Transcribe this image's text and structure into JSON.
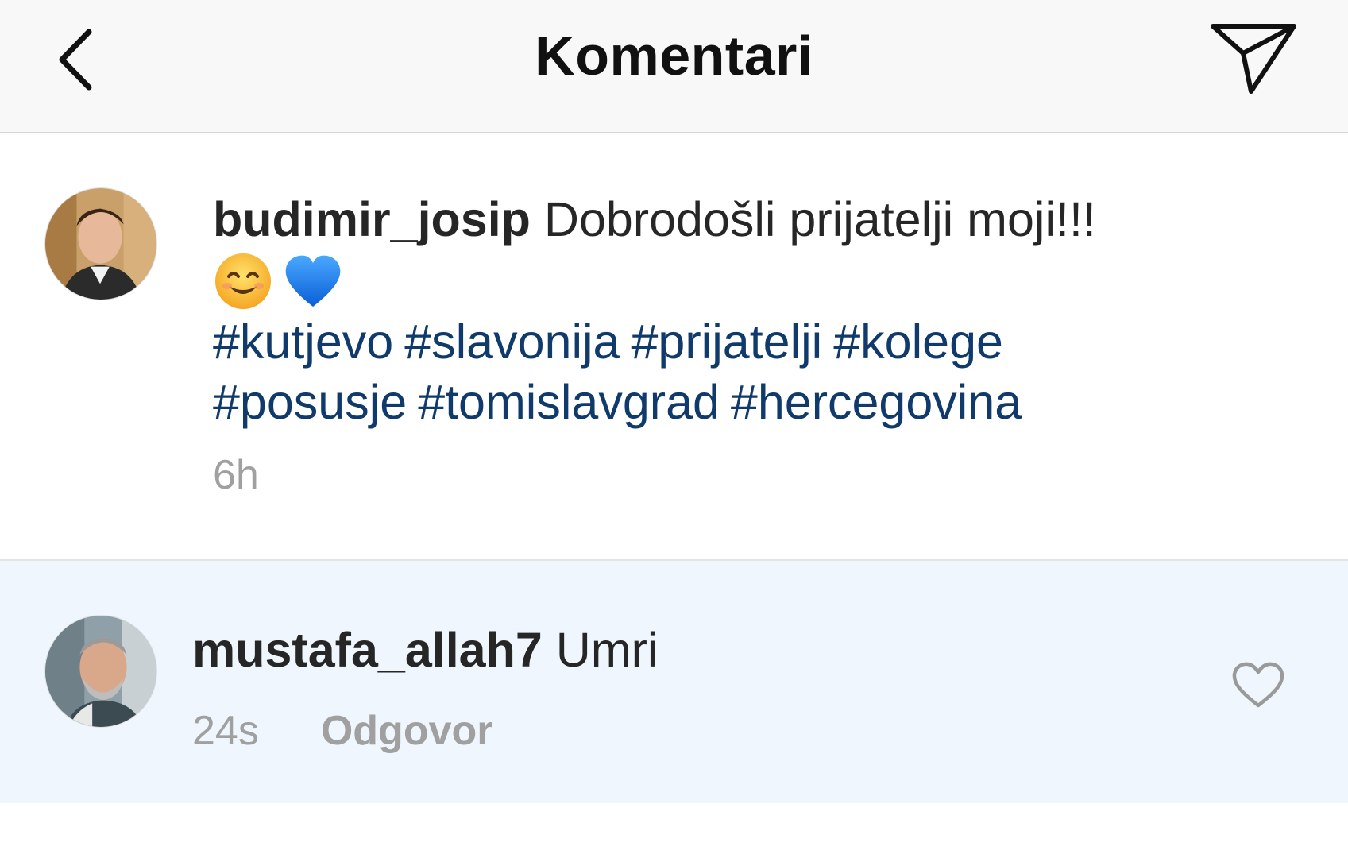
{
  "header": {
    "title": "Komentari",
    "back_icon": "chevron-left-icon",
    "send_icon": "paper-plane-icon"
  },
  "caption": {
    "username": "budimir_josip",
    "text": "Dobrodošli prijatelji moji!!!",
    "emojis": [
      "smiling-face-icon",
      "blue-heart-icon"
    ],
    "hashtags": [
      "#kutjevo",
      "#slavonija",
      "#prijatelji",
      "#kolege",
      "#posusje",
      "#tomislavgrad",
      "#hercegovina"
    ],
    "time": "6h"
  },
  "comment": {
    "username": "mustafa_allah7",
    "text": "Umri",
    "time": "24s",
    "reply_label": "Odgovor",
    "like_icon": "heart-outline-icon"
  },
  "colors": {
    "header_bg": "#f8f8f8",
    "hashtag": "#0f3a6b",
    "comment_bg": "#eff6fd",
    "muted_text": "#a0a0a0"
  }
}
